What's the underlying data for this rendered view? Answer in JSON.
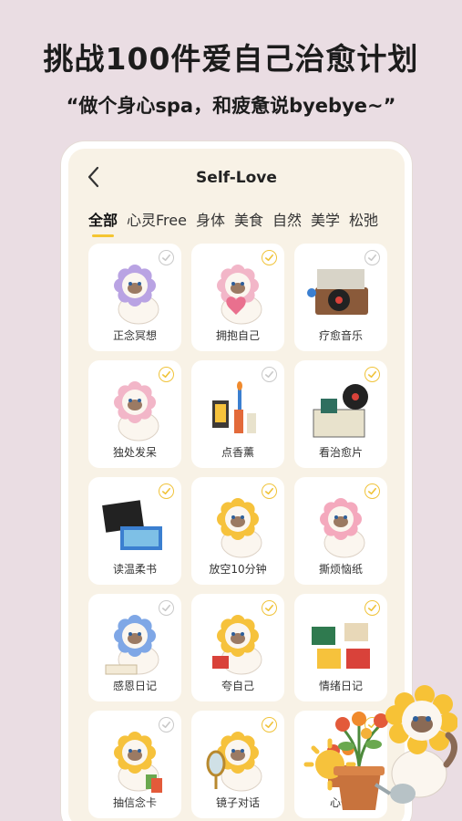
{
  "promo": {
    "headline": "挑战100件爱自己治愈计划",
    "subline": "“做个身心spa，和疲惫说byebye~”"
  },
  "app": {
    "title": "Self-Love"
  },
  "tabs": [
    {
      "label": "全部",
      "active": true
    },
    {
      "label": "心灵Free",
      "active": false
    },
    {
      "label": "身体",
      "active": false
    },
    {
      "label": "美食",
      "active": false
    },
    {
      "label": "自然",
      "active": false
    },
    {
      "label": "美学",
      "active": false
    },
    {
      "label": "松弛",
      "active": false
    }
  ],
  "items": [
    {
      "label": "正念冥想",
      "checked": false,
      "icon": "cat-purple-flower-icon"
    },
    {
      "label": "拥抱自己",
      "checked": true,
      "icon": "cat-hug-heart-icon"
    },
    {
      "label": "疗愈音乐",
      "checked": false,
      "icon": "record-player-icon"
    },
    {
      "label": "独处发呆",
      "checked": true,
      "icon": "cat-lying-bow-icon"
    },
    {
      "label": "点香薰",
      "checked": false,
      "icon": "candles-lantern-icon"
    },
    {
      "label": "看治愈片",
      "checked": true,
      "icon": "film-box-icon"
    },
    {
      "label": "读温柔书",
      "checked": true,
      "icon": "books-icon"
    },
    {
      "label": "放空10分钟",
      "checked": true,
      "icon": "cat-yellow-flower-icon"
    },
    {
      "label": "撕烦恼纸",
      "checked": true,
      "icon": "cat-pink-flower-icon"
    },
    {
      "label": "感恩日记",
      "checked": false,
      "icon": "cat-blue-flower-writing-icon"
    },
    {
      "label": "夸自己",
      "checked": true,
      "icon": "cat-yellow-flower-book-icon"
    },
    {
      "label": "情绪日记",
      "checked": true,
      "icon": "journals-icon"
    },
    {
      "label": "抽信念卡",
      "checked": false,
      "icon": "cat-cards-icon"
    },
    {
      "label": "镜子对话",
      "checked": true,
      "icon": "cat-mirror-icon"
    },
    {
      "label": "心情",
      "checked": true,
      "icon": "plant-pot-icon"
    }
  ],
  "colors": {
    "accent": "#f4c531",
    "background": "#eadde3",
    "card": "#ffffff",
    "screen": "#f8f2e6"
  }
}
